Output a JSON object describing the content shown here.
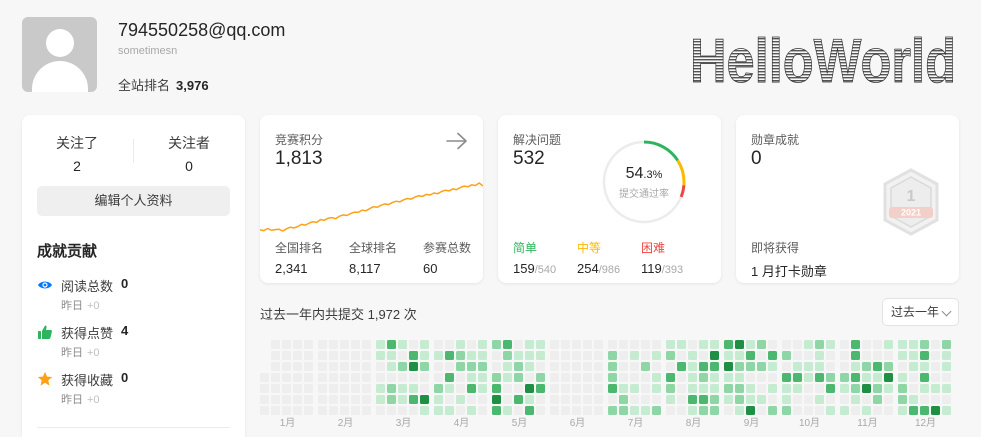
{
  "profile": {
    "email": "794550258@qq.com",
    "username": "sometimesn",
    "rank_label": "全站排名",
    "rank_value": "3,976",
    "banner_text": "HelloWorld"
  },
  "follow": {
    "following_label": "关注了",
    "following_value": "2",
    "followers_label": "关注者",
    "followers_value": "0",
    "edit_button": "编辑个人资料"
  },
  "contributions": {
    "title": "成就贡献",
    "items": [
      {
        "label": "阅读总数",
        "value": "0",
        "sub_label": "昨日",
        "sub_value": "+0",
        "icon": "eye-icon",
        "color": "#007aff"
      },
      {
        "label": "获得点赞",
        "value": "4",
        "sub_label": "昨日",
        "sub_value": "+0",
        "icon": "thumbs-up-icon",
        "color": "#2db55d"
      },
      {
        "label": "获得收藏",
        "value": "0",
        "sub_label": "昨日",
        "sub_value": "+0",
        "icon": "star-icon",
        "color": "#ffa116"
      }
    ]
  },
  "contest": {
    "label": "竞赛积分",
    "value": "1,813",
    "national_rank_label": "全国排名",
    "national_rank_value": "2,341",
    "global_rank_label": "全球排名",
    "global_rank_value": "8,117",
    "contests_label": "参赛总数",
    "contests_value": "60",
    "line_color": "#ffa116",
    "rating_history": [
      1470,
      1465,
      1480,
      1468,
      1472,
      1475,
      1462,
      1478,
      1490,
      1485,
      1495,
      1510,
      1505,
      1520,
      1530,
      1525,
      1545,
      1540,
      1555,
      1560,
      1552,
      1570,
      1580,
      1575,
      1590,
      1600,
      1598,
      1615,
      1610,
      1625,
      1640,
      1635,
      1650,
      1660,
      1655,
      1670,
      1680,
      1675,
      1690,
      1700,
      1695,
      1710,
      1720,
      1715,
      1730,
      1725,
      1740,
      1735,
      1750,
      1760,
      1755,
      1770,
      1765,
      1780,
      1790,
      1785,
      1800,
      1795,
      1813,
      1790
    ]
  },
  "problems": {
    "label": "解决问题",
    "value": "532",
    "percent": "54",
    "percent_decimal": ".3%",
    "percent_label": "提交通过率",
    "easy_label": "简单",
    "easy_value": "159",
    "easy_total": "540",
    "medium_label": "中等",
    "medium_value": "254",
    "medium_total": "986",
    "hard_label": "困难",
    "hard_value": "119",
    "hard_total": "393",
    "easy_color": "#2db55d",
    "medium_color": "#ffb800",
    "hard_color": "#ef4743"
  },
  "badges": {
    "label": "勋章成就",
    "value": "0",
    "upcoming_label": "即将获得",
    "upcoming_value": "1 月打卡勋章",
    "badge_year": "2021",
    "badge_number": "1"
  },
  "submissions": {
    "title": "过去一年内共提交 1,972 次",
    "range_select": "过去一年",
    "months": [
      "1月",
      "2月",
      "3月",
      "4月",
      "5月",
      "6月",
      "7月",
      "8月",
      "9月",
      "10月",
      "11月",
      "12月"
    ],
    "level_colors": [
      "#eeeeee",
      "#c5ebd1",
      "#8fd6a6",
      "#4cb86f",
      "#1f8f43"
    ]
  }
}
